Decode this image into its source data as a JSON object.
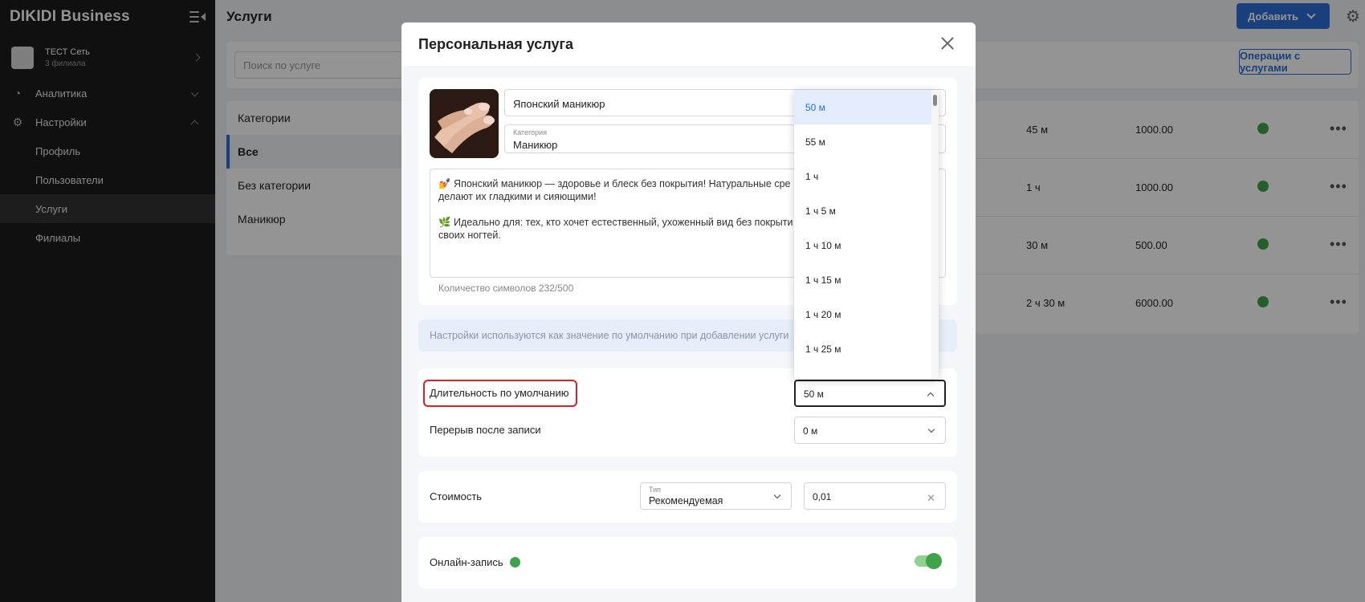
{
  "sidebar": {
    "brand": "DIKIDI Business",
    "network": {
      "name": "ТЕСТ Сеть",
      "sub": "3 филиала"
    },
    "nav": {
      "analytics": "Аналитика",
      "settings": "Настройки"
    },
    "sub_items": [
      "Профиль",
      "Пользователи",
      "Услуги",
      "Филиалы"
    ],
    "active_sub": "Услуги"
  },
  "main": {
    "title": "Услуги",
    "add_button": "Добавить",
    "search_placeholder": "Поиск по услуге",
    "ops_button": "Операции с услугами",
    "categories": [
      "Категории",
      "Все",
      "Без категории",
      "Маникюр"
    ],
    "active_category": "Все",
    "rows": [
      {
        "duration": "45 м",
        "price": "1000.00"
      },
      {
        "duration": "1 ч",
        "price": "1000.00"
      },
      {
        "duration": "30 м",
        "price": "500.00"
      },
      {
        "duration": "2 ч 30 м",
        "price": "6000.00"
      }
    ],
    "row_menu": "•••"
  },
  "modal": {
    "title": "Персональная услуга",
    "name_value": "Японский маникюр",
    "category_label": "Категория",
    "category_value": "Маникюр",
    "description": [
      "💅 Японский маникюр — здоровье и блеск без покрытия! Натуральные сре",
      "делают их гладкими и сияющими!",
      "🌿 Идеально для: тех, кто хочет естественный, ухоженный вид без покрыти",
      "своих ногтей."
    ],
    "char_count": "Количество символов 232/500",
    "info_text": "Настройки используются как значение по умолчанию при добавлении услуги",
    "default_duration_label": "Длительность по умолчанию",
    "default_duration_value": "50 м",
    "break_label": "Перерыв после записи",
    "break_value": "0 м",
    "cost_label": "Стоимость",
    "cost_type_label": "Тип",
    "cost_type_value": "Рекомендуемая",
    "cost_value": "0,01",
    "online_label": "Онлайн-запись",
    "online_enabled": true
  },
  "dropdown": {
    "options": [
      "50 м",
      "55 м",
      "1 ч",
      "1 ч 5 м",
      "1 ч 10 м",
      "1 ч 15 м",
      "1 ч 20 м",
      "1 ч 25 м"
    ],
    "selected": "50 м"
  },
  "colors": {
    "accent": "#2b6fd6",
    "sidebar_bg": "#1c1c1e",
    "highlight": "#e02020",
    "online_green": "#3ea34b"
  }
}
